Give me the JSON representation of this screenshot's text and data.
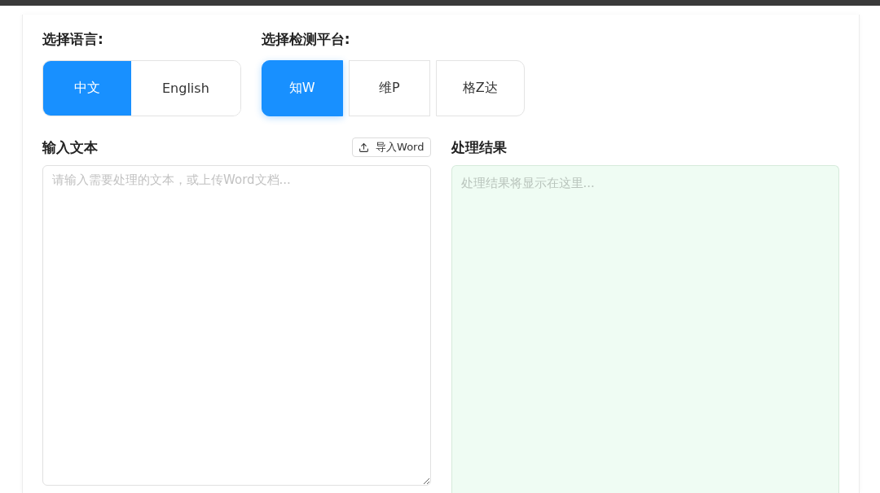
{
  "language": {
    "label": "选择语言:",
    "options": [
      {
        "label": "中文",
        "selected": true
      },
      {
        "label": "English",
        "selected": false
      }
    ]
  },
  "platform": {
    "label": "选择检测平台:",
    "options": [
      {
        "label": "知W",
        "selected": true
      },
      {
        "label": "维P",
        "selected": false
      },
      {
        "label": "格Z达",
        "selected": false
      }
    ]
  },
  "input": {
    "label": "输入文本",
    "import_button": "导入Word",
    "placeholder": "请输入需要处理的文本，或上传Word文档..."
  },
  "result": {
    "label": "处理结果",
    "placeholder": "处理结果将显示在这里..."
  }
}
